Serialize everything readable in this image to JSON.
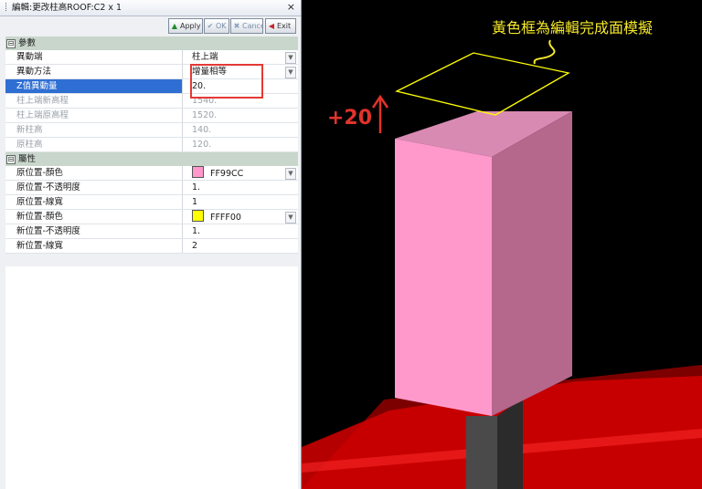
{
  "window": {
    "title": "編輯:更改柱高ROOF:C2 x 1",
    "close_glyph": "×"
  },
  "toolbar": {
    "apply_label": "Apply",
    "ok_label": "OK",
    "cancel_label": "Cancel",
    "exit_label": "Exit"
  },
  "categories": {
    "params": {
      "label": "參數",
      "toggle": "⊟"
    },
    "props": {
      "label": "屬性",
      "toggle": "⊟"
    }
  },
  "params": [
    {
      "name": "異動端",
      "value": "柱上端"
    },
    {
      "name": "異動方法",
      "value": "增量相等"
    },
    {
      "name": "Z值異動量",
      "value": "20."
    },
    {
      "name": "柱上端新高程",
      "value": "1540."
    },
    {
      "name": "柱上端原高程",
      "value": "1520."
    },
    {
      "name": "新柱高",
      "value": "140."
    },
    {
      "name": "原柱高",
      "value": "120."
    }
  ],
  "props": [
    {
      "name": "原位置-顏色",
      "value": "FF99CC",
      "color": "#FF99CC"
    },
    {
      "name": "原位置-不透明度",
      "value": "1."
    },
    {
      "name": "原位置-線寬",
      "value": "1"
    },
    {
      "name": "新位置-顏色",
      "value": "FFFF00",
      "color": "#FFFF00"
    },
    {
      "name": "新位置-不透明度",
      "value": "1."
    },
    {
      "name": "新位置-線寬",
      "value": "2"
    }
  ],
  "viewport": {
    "annotation": "黃色框為編輯完成面模擬",
    "offset_label": "+20",
    "colors": {
      "column_top": "#d98ab3",
      "column_front": "#ff99cc",
      "column_side": "#b5678c",
      "preview_outline": "#ffff00",
      "slab": "#d40000",
      "annotation": "#f5e92a"
    }
  }
}
